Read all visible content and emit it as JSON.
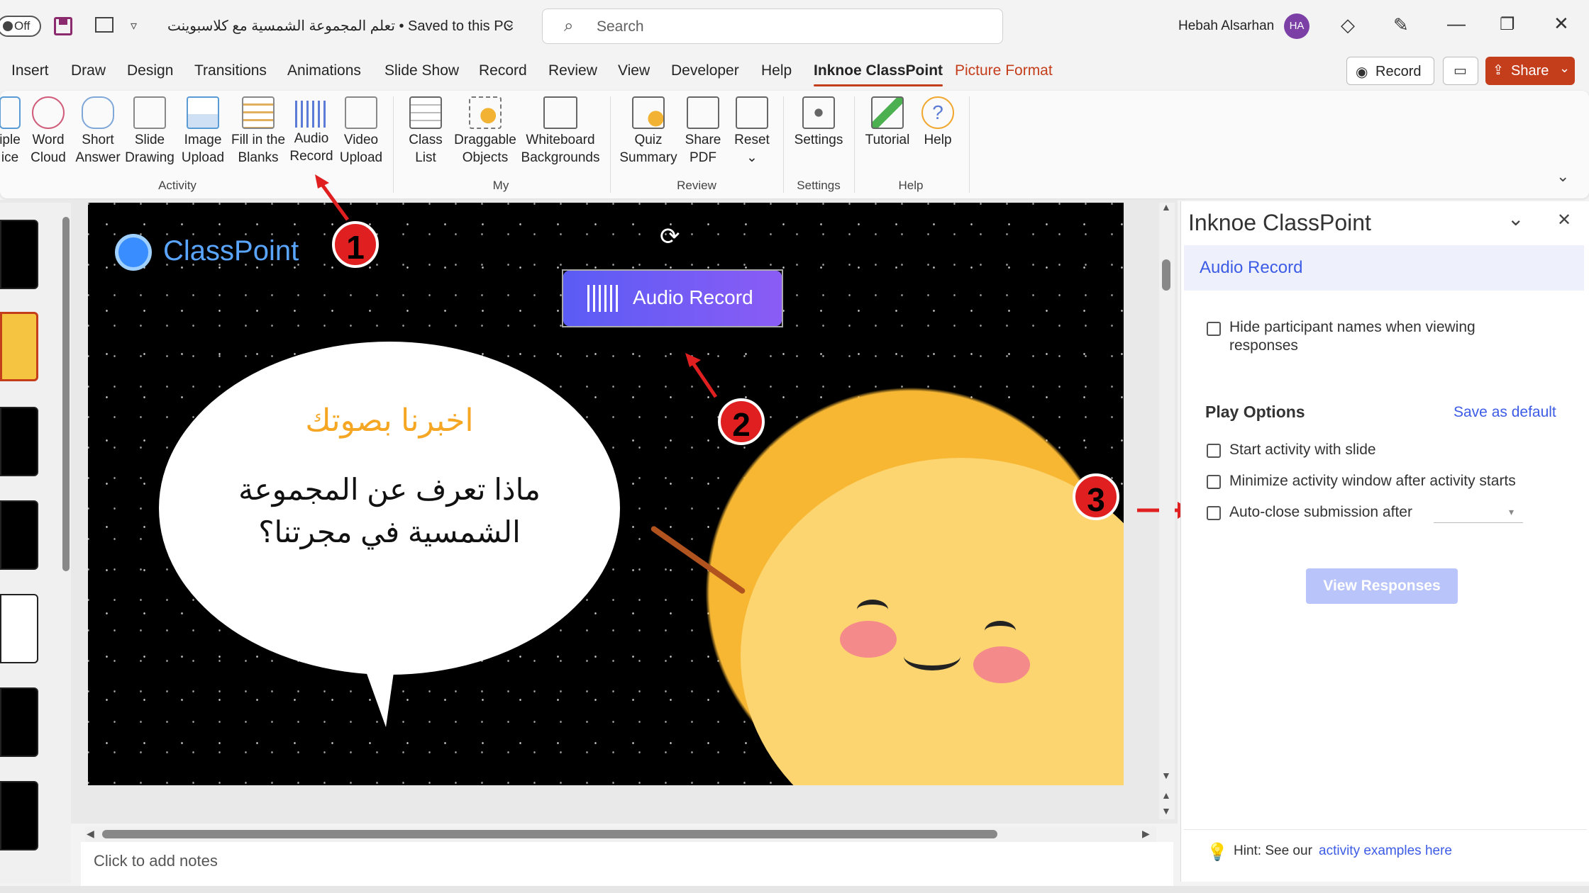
{
  "titlebar": {
    "autosave_label": "Off",
    "doc_title": "تعلم المجموعة الشمسية مع كلاسبوينت • Saved to this PC",
    "search_placeholder": "Search",
    "user_name": "Hebah Alsarhan",
    "user_initials": "HA"
  },
  "tabs": [
    "Insert",
    "Draw",
    "Design",
    "Transitions",
    "Animations",
    "Slide Show",
    "Record",
    "Review",
    "View",
    "Developer",
    "Help",
    "Inknoe ClassPoint",
    "Picture Format"
  ],
  "tab_actions": {
    "record_label": "Record",
    "share_label": "Share"
  },
  "ribbon": {
    "activity": [
      {
        "line1": "iple",
        "line2": "ice"
      },
      {
        "line1": "Word",
        "line2": "Cloud"
      },
      {
        "line1": "Short",
        "line2": "Answer"
      },
      {
        "line1": "Slide",
        "line2": "Drawing"
      },
      {
        "line1": "Image",
        "line2": "Upload"
      },
      {
        "line1": "Fill in the",
        "line2": "Blanks"
      },
      {
        "line1": "Audio",
        "line2": "Record"
      },
      {
        "line1": "Video",
        "line2": "Upload"
      }
    ],
    "activity_group": "Activity",
    "my": [
      {
        "line1": "Class",
        "line2": "List"
      },
      {
        "line1": "Draggable",
        "line2": "Objects"
      },
      {
        "line1": "Whiteboard",
        "line2": "Backgrounds"
      }
    ],
    "my_group": "My",
    "review": [
      {
        "line1": "Quiz",
        "line2": "Summary"
      },
      {
        "line1": "Share",
        "line2": "PDF"
      },
      {
        "line1": "Reset",
        "line2": "⌄"
      }
    ],
    "review_group": "Review",
    "settings": {
      "line1": "Settings"
    },
    "settings_group": "Settings",
    "help": [
      {
        "line1": "Tutorial"
      },
      {
        "line1": "Help"
      }
    ],
    "help_group": "Help"
  },
  "slide": {
    "logo_text": "ClassPoint",
    "audio_button_label": "Audio Record",
    "bubble_heading": "اخبرنا بصوتك",
    "bubble_line1": "ماذا تعرف عن المجموعة",
    "bubble_line2": "الشمسية في مجرتنا؟"
  },
  "annotations": [
    "1",
    "2",
    "3"
  ],
  "notes_placeholder": "Click to add notes",
  "pane": {
    "title": "Inknoe ClassPoint",
    "section_title": "Audio Record",
    "hide_names_line1": "Hide participant names when viewing",
    "hide_names_line2": "responses",
    "play_options": "Play Options",
    "save_default": "Save as default",
    "opt_start": "Start activity with slide",
    "opt_minimize": "Minimize activity window after activity starts",
    "opt_autoclose": "Auto-close submission after",
    "view_responses": "View Responses",
    "hint_prefix": "Hint: See our",
    "hint_link": "activity examples here"
  },
  "colors": {
    "accent": "#c43e1c",
    "link": "#3d5ce6",
    "audio_button": "#6c5cf5"
  }
}
